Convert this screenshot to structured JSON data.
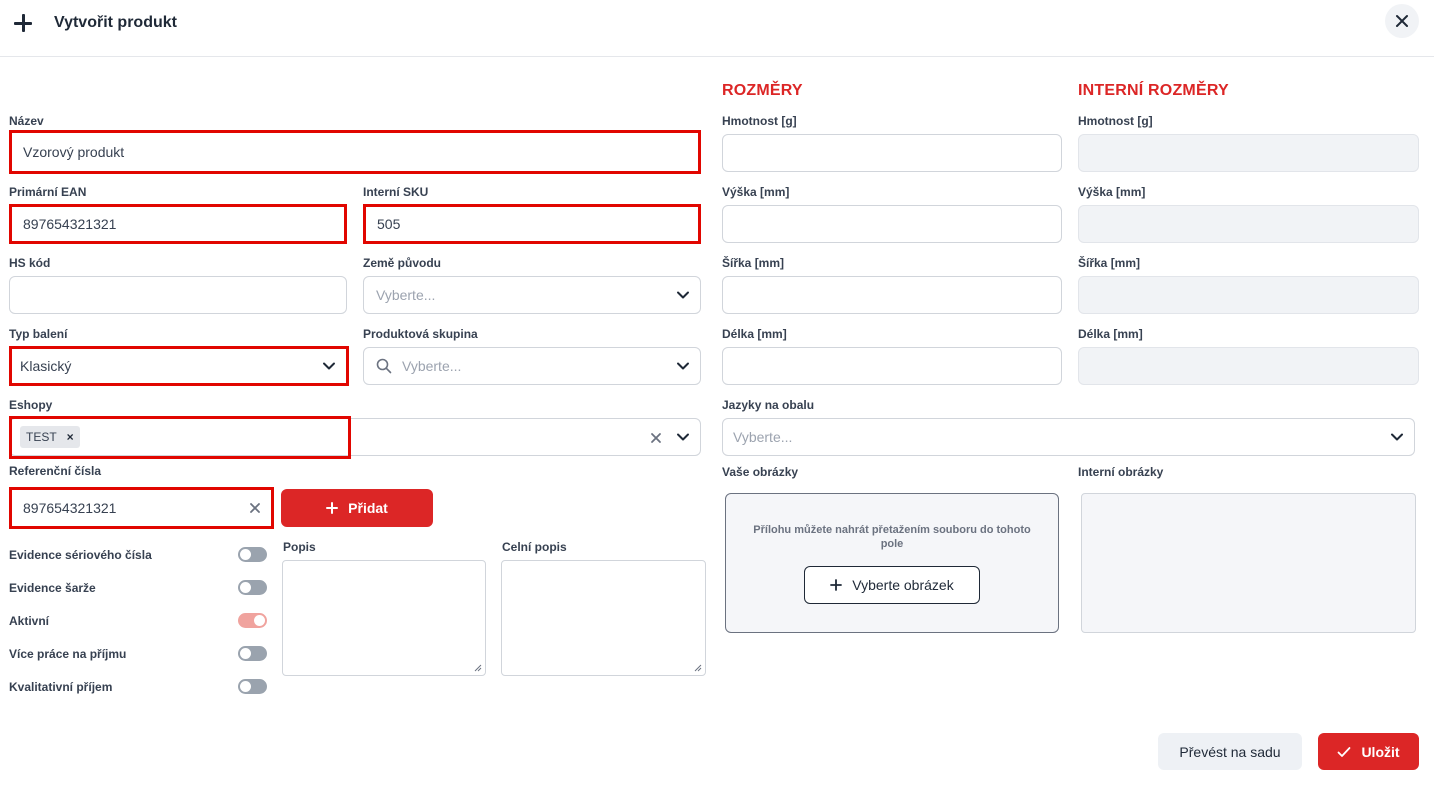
{
  "header": {
    "title": "Vytvořit produkt"
  },
  "form": {
    "name": {
      "label": "Název",
      "value": "Vzorový produkt"
    },
    "primary_ean": {
      "label": "Primární EAN",
      "value": "897654321321"
    },
    "internal_sku": {
      "label": "Interní SKU",
      "value": "505"
    },
    "hs_code": {
      "label": "HS kód",
      "value": ""
    },
    "country": {
      "label": "Země původu",
      "placeholder": "Vyberte..."
    },
    "package_type": {
      "label": "Typ balení",
      "value": "Klasický"
    },
    "product_group": {
      "label": "Produktová skupina",
      "placeholder": "Vyberte..."
    },
    "eshops": {
      "label": "Eshopy",
      "tags": [
        "TEST"
      ]
    },
    "reference_numbers": {
      "label": "Referenční čísla",
      "value": "897654321321",
      "add_label": "Přidat"
    },
    "toggles": [
      {
        "label": "Evidence sériového čísla",
        "on": false
      },
      {
        "label": "Evidence šarže",
        "on": false
      },
      {
        "label": "Aktivní",
        "on": true
      },
      {
        "label": "Více práce na příjmu",
        "on": false
      },
      {
        "label": "Kvalitativní příjem",
        "on": false
      }
    ],
    "description": {
      "label": "Popis"
    },
    "customs_description": {
      "label": "Celní popis"
    }
  },
  "dimensions": {
    "title": "ROZMĚRY",
    "weight_label": "Hmotnost [g]",
    "height_label": "Výška [mm]",
    "width_label": "Šířka [mm]",
    "length_label": "Délka [mm]"
  },
  "internal_dimensions": {
    "title": "INTERNÍ ROZMĚRY",
    "weight_label": "Hmotnost [g]",
    "height_label": "Výška [mm]",
    "width_label": "Šířka [mm]",
    "length_label": "Délka [mm]"
  },
  "languages": {
    "label": "Jazyky na obalu",
    "placeholder": "Vyberte..."
  },
  "images": {
    "your_label": "Vaše obrázky",
    "drop_hint": "Přílohu můžete nahrát přetažením souboru do tohoto pole",
    "pick_label": "Vyberte obrázek",
    "internal_label": "Interní obrázky"
  },
  "footer": {
    "convert_label": "Převést na sadu",
    "save_label": "Uložit"
  },
  "colors": {
    "accent": "#dc2626",
    "highlight": "#e10600"
  }
}
